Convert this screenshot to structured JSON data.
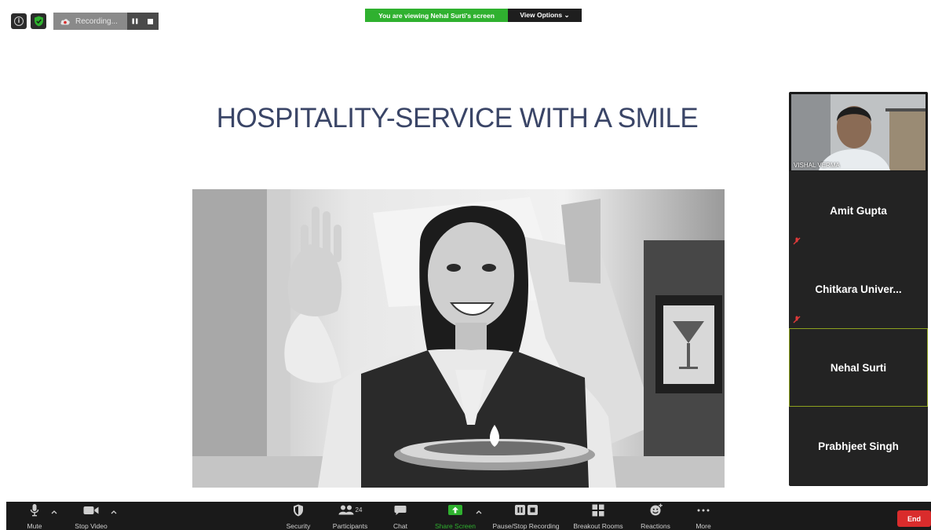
{
  "meeting": {
    "recording_label": "Recording...",
    "share_banner_text": "You are viewing Nehal Surti's screen",
    "view_options_label": "View Options ⌄"
  },
  "slide": {
    "title": "HOSPITALITY-SERVICE WITH A SMILE",
    "image_icon": "photo-woman-waving-holding-plate"
  },
  "participants": {
    "video_label": "VISHAL VERMA",
    "tiles": [
      {
        "name": "Amit Gupta",
        "muted": true
      },
      {
        "name": "Chitkara  Univer...",
        "muted": true
      },
      {
        "name": "Nehal Surti",
        "muted": false,
        "active": true
      },
      {
        "name": "Prabhjeet Singh",
        "muted": false
      }
    ]
  },
  "toolbar": {
    "mute_label": "Mute",
    "stop_video_label": "Stop Video",
    "security_label": "Security",
    "participants_label": "Participants",
    "participants_count": "24",
    "chat_label": "Chat",
    "share_screen_label": "Share Screen",
    "pause_stop_recording_label": "Pause/Stop Recording",
    "breakout_rooms_label": "Breakout Rooms",
    "reactions_label": "Reactions",
    "more_label": "More",
    "end_label": "End"
  },
  "colors": {
    "accent_green": "#2fb12f",
    "end_red": "#d92c2c",
    "title_navy": "#3a4567",
    "panel_bg": "#1a1a1a"
  }
}
